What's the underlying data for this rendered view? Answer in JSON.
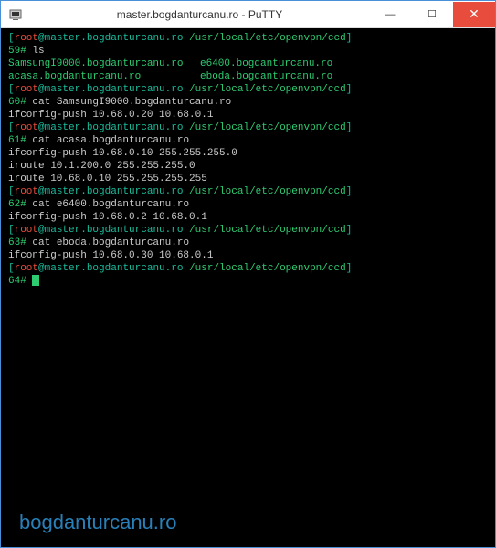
{
  "window": {
    "title": "master.bogdanturcanu.ro - PuTTY"
  },
  "prompt": {
    "bracket_open": "[",
    "bracket_close": "]",
    "user": "root",
    "at": "@",
    "host": "master.bogdanturcanu.ro",
    "path": " /usr/local/etc/openvpn/ccd"
  },
  "lines": {
    "p59": "59#",
    "cmd59": " ls",
    "file1": "SamsungI9000.bogdanturcanu.ro",
    "file2": "e6400.bogdanturcanu.ro",
    "file3": "acasa.bogdanturcanu.ro",
    "file4": "eboda.bogdanturcanu.ro",
    "p60": "60#",
    "cmd60": " cat SamsungI9000.bogdanturcanu.ro",
    "out60": "ifconfig-push 10.68.0.20 10.68.0.1",
    "p61": "61#",
    "cmd61": " cat acasa.bogdanturcanu.ro",
    "out61a": "ifconfig-push 10.68.0.10 255.255.255.0",
    "out61b": "iroute 10.1.200.0 255.255.255.0",
    "out61c": "iroute 10.68.0.10 255.255.255.255",
    "p62": "62#",
    "cmd62": " cat e6400.bogdanturcanu.ro",
    "out62": "ifconfig-push 10.68.0.2 10.68.0.1",
    "p63": "63#",
    "cmd63": " cat eboda.bogdanturcanu.ro",
    "out63": "ifconfig-push 10.68.0.30 10.68.0.1",
    "p64": "64# "
  },
  "watermark": "bogdanturcanu.ro"
}
